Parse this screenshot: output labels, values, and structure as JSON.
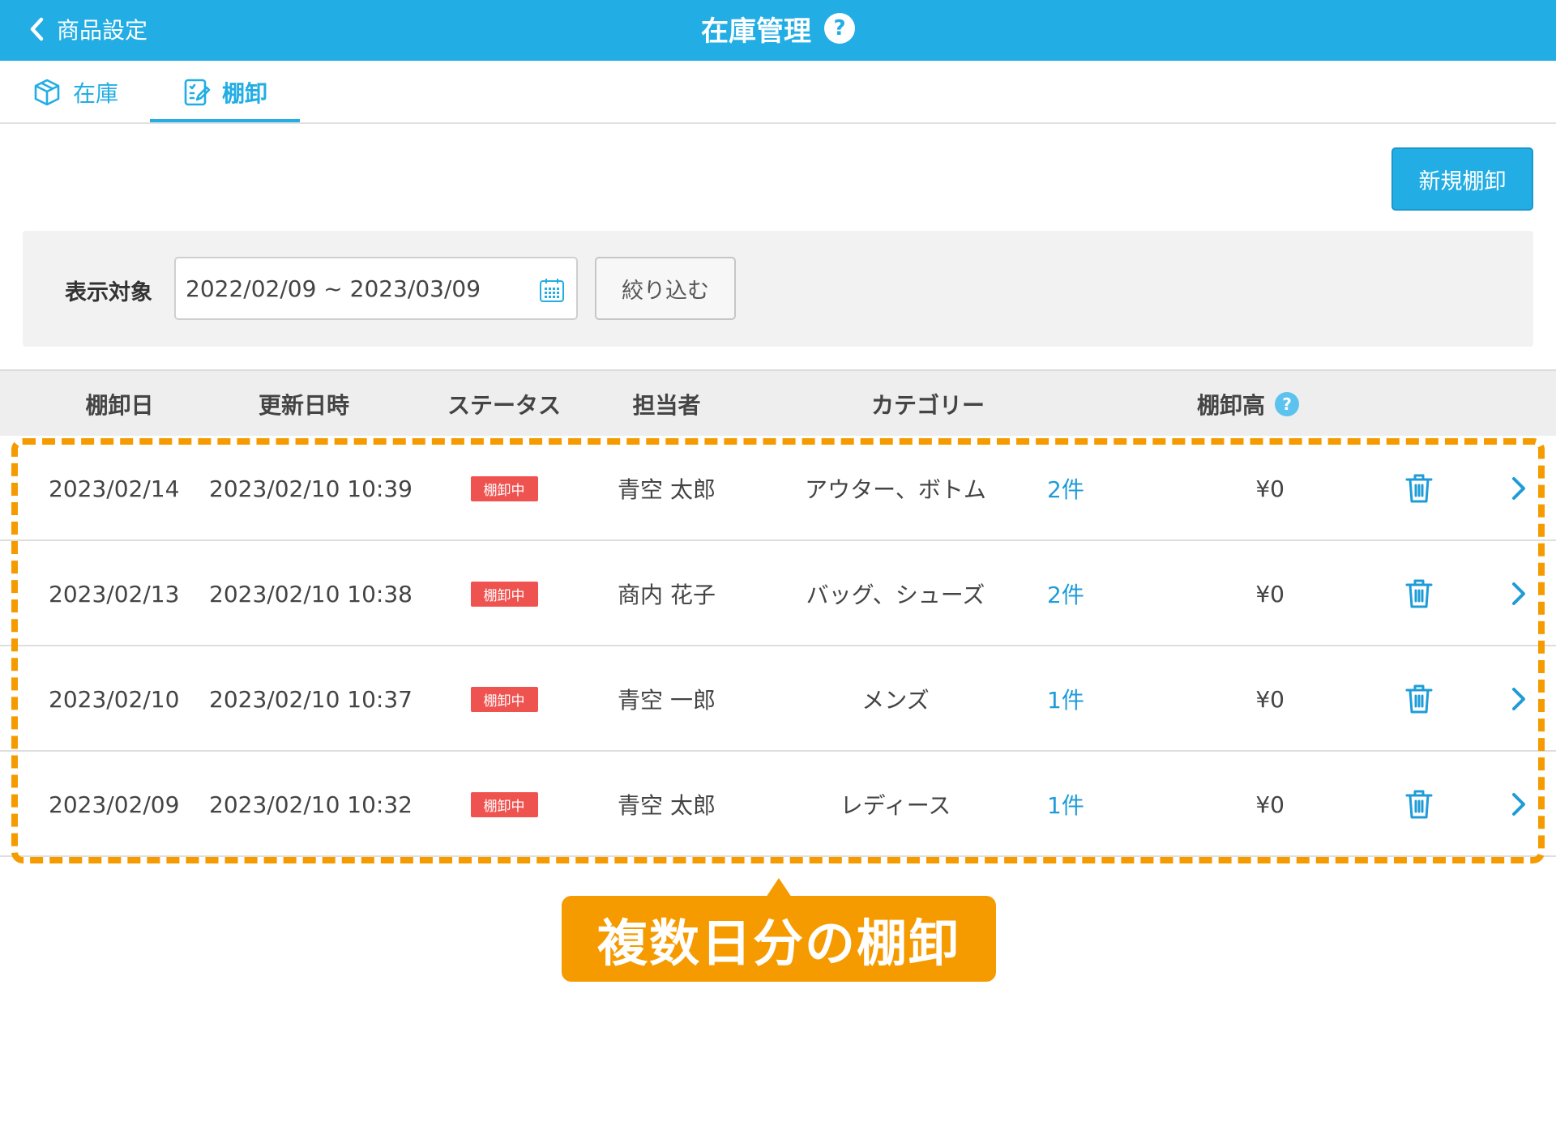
{
  "header": {
    "back_label": "商品設定",
    "title": "在庫管理",
    "help_glyph": "?",
    "bg_color": "#22ade4"
  },
  "tabs": [
    {
      "label": "在庫",
      "icon": "box-icon",
      "active": false
    },
    {
      "label": "棚卸",
      "icon": "clipboard-edit-icon",
      "active": true
    }
  ],
  "toolbar": {
    "new_button_label": "新規棚卸"
  },
  "filter": {
    "label": "表示対象",
    "date_range": "2022/02/09 ~ 2023/03/09",
    "narrow_button_label": "絞り込む"
  },
  "table": {
    "columns": [
      "棚卸日",
      "更新日時",
      "ステータス",
      "担当者",
      "カテゴリー",
      "棚卸高"
    ],
    "amount_help_glyph": "?",
    "rows": [
      {
        "date": "2023/02/14",
        "updated": "2023/02/10 10:39",
        "status": "棚卸中",
        "person": "青空 太郎",
        "category": "アウター、ボトム",
        "count": "2件",
        "amount": "¥0"
      },
      {
        "date": "2023/02/13",
        "updated": "2023/02/10 10:38",
        "status": "棚卸中",
        "person": "商内 花子",
        "category": "バッグ、シューズ",
        "count": "2件",
        "amount": "¥0"
      },
      {
        "date": "2023/02/10",
        "updated": "2023/02/10 10:37",
        "status": "棚卸中",
        "person": "青空 一郎",
        "category": "メンズ",
        "count": "1件",
        "amount": "¥0"
      },
      {
        "date": "2023/02/09",
        "updated": "2023/02/10 10:32",
        "status": "棚卸中",
        "person": "青空 太郎",
        "category": "レディース",
        "count": "1件",
        "amount": "¥0"
      }
    ]
  },
  "annotation": {
    "callout_text": "複数日分の棚卸",
    "color": "#f59b00"
  }
}
